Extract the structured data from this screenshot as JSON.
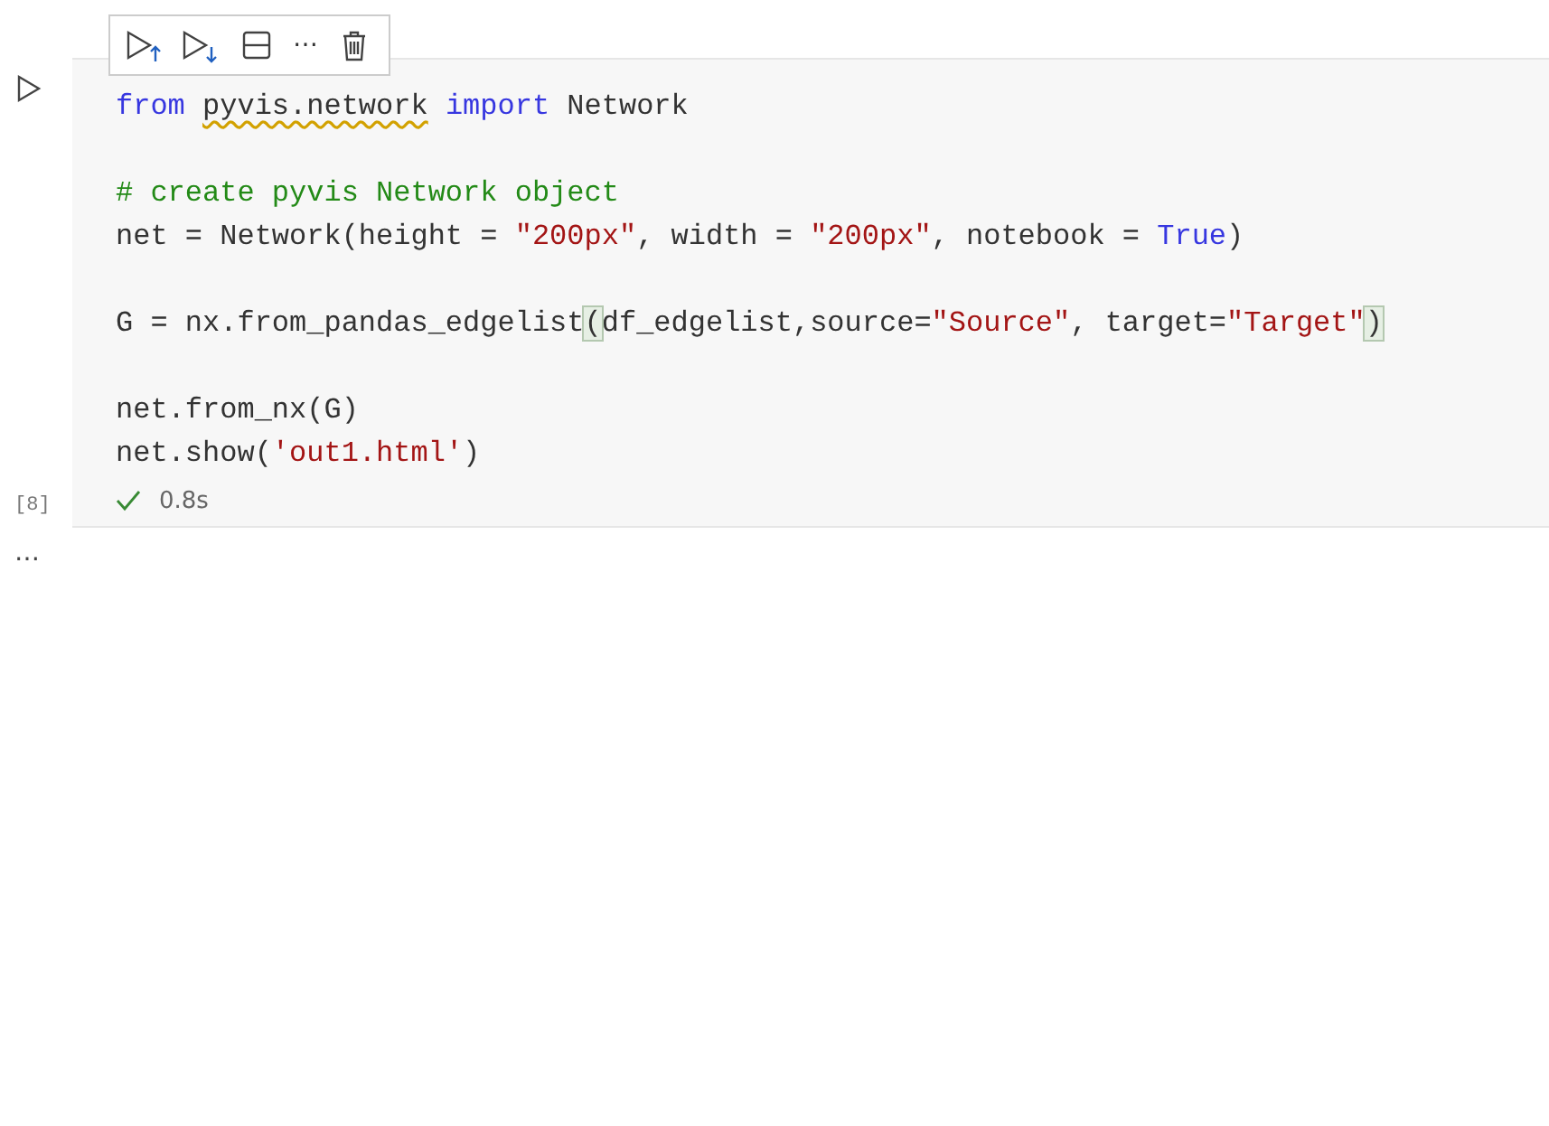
{
  "cell": {
    "execution_count": "[8]",
    "duration": "0.8s",
    "succeeded": true,
    "toolbar": [
      {
        "kind": "run-above"
      },
      {
        "kind": "run-below"
      },
      {
        "kind": "split"
      },
      {
        "kind": "more",
        "text": "⋯"
      },
      {
        "kind": "delete"
      }
    ],
    "lines": [
      {
        "kind": "code",
        "tokens": [
          {
            "kind": "keyword",
            "text": "from "
          },
          {
            "kind": "warning",
            "text": "pyvis.network"
          },
          {
            "kind": "keyword",
            "text": " import"
          },
          {
            "kind": "plain",
            "text": " Network"
          }
        ]
      },
      {
        "kind": "blank"
      },
      {
        "kind": "code",
        "tokens": [
          {
            "kind": "comment",
            "text": "# create pyvis Network object"
          }
        ]
      },
      {
        "kind": "code",
        "tokens": [
          {
            "kind": "plain",
            "text": "net = Network(height = "
          },
          {
            "kind": "string",
            "text": "\"200px\""
          },
          {
            "kind": "plain",
            "text": ", width = "
          },
          {
            "kind": "string",
            "text": "\"200px\""
          },
          {
            "kind": "plain",
            "text": ", notebook = "
          },
          {
            "kind": "keyword",
            "text": "True"
          },
          {
            "kind": "plain",
            "text": ")"
          }
        ]
      },
      {
        "kind": "blank"
      },
      {
        "kind": "code",
        "tokens": [
          {
            "kind": "plain",
            "text": "G = nx.from_pandas_edgelist"
          },
          {
            "kind": "bracket",
            "text": "("
          },
          {
            "kind": "plain",
            "text": "df_edgelist,source="
          },
          {
            "kind": "string",
            "text": "\"Source\""
          },
          {
            "kind": "plain",
            "text": ", target="
          },
          {
            "kind": "string",
            "text": "\"Target\""
          },
          {
            "kind": "bracket",
            "text": ")"
          }
        ]
      },
      {
        "kind": "blank"
      },
      {
        "kind": "code",
        "tokens": [
          {
            "kind": "plain",
            "text": "net.from_nx(G)"
          }
        ]
      },
      {
        "kind": "code",
        "tokens": [
          {
            "kind": "plain",
            "text": "net.show("
          },
          {
            "kind": "string",
            "text": "'out1.html'"
          },
          {
            "kind": "plain",
            "text": ")"
          }
        ]
      }
    ]
  },
  "output": {
    "text": "…"
  }
}
